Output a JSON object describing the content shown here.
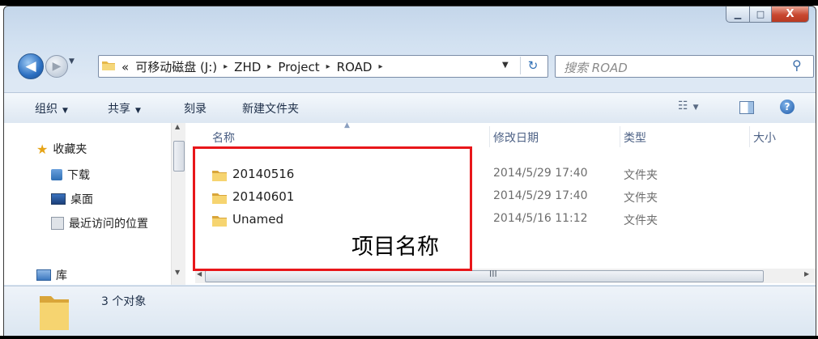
{
  "window": {
    "caption": {
      "minimize": "▁",
      "maximize": "□",
      "close": "X"
    }
  },
  "address": {
    "back_icon": "back-arrow-icon",
    "crumbs": [
      "«",
      "可移动磁盘 (J:)",
      "ZHD",
      "Project",
      "ROAD"
    ],
    "separator": "▸"
  },
  "search": {
    "placeholder": "搜索 ROAD"
  },
  "toolbar": {
    "organize": "组织",
    "share": "共享",
    "burn": "刻录",
    "new_folder": "新建文件夹"
  },
  "navpane": {
    "favorites": "收藏夹",
    "downloads": "下载",
    "desktop": "桌面",
    "recent": "最近访问的位置",
    "libraries": "库"
  },
  "columns": {
    "name": "名称",
    "modified": "修改日期",
    "type": "类型",
    "size": "大小"
  },
  "files": [
    {
      "name": "20140516",
      "modified": "2014/5/29 17:40",
      "type": "文件夹"
    },
    {
      "name": "20140601",
      "modified": "2014/5/29 17:40",
      "type": "文件夹"
    },
    {
      "name": "Unamed",
      "modified": "2014/5/16 11:12",
      "type": "文件夹"
    }
  ],
  "annotation": {
    "label": "项目名称",
    "color": "#e8161a"
  },
  "hscroll_grip": "III",
  "details": {
    "count": "3 个对象"
  }
}
